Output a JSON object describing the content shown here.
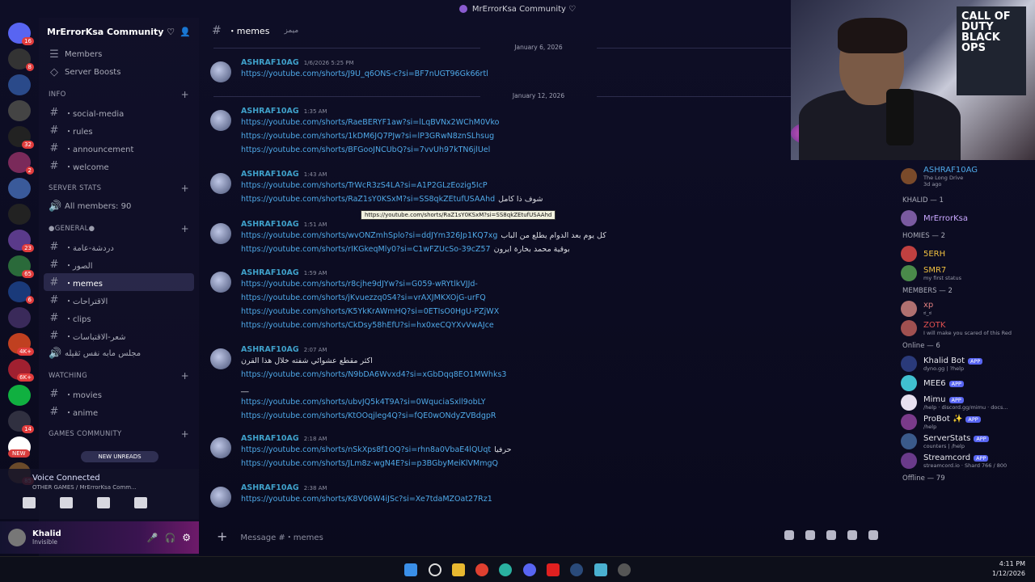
{
  "window_title": "MrErrorKsa Community ♡",
  "server": {
    "name": "MrErrorKsa Community ♡",
    "top_items": [
      "Members",
      "Server Boosts"
    ],
    "rail_badges": [
      "16",
      "8",
      "",
      "",
      "32",
      "2",
      "",
      "",
      "23",
      "65",
      "6",
      "",
      "4K+",
      "6K+",
      "",
      "14",
      "",
      "85"
    ],
    "new_badge": "NEW"
  },
  "categories": [
    {
      "name": "INFO",
      "channels": [
        {
          "name": "・social-media",
          "icon": "#"
        },
        {
          "name": "・rules",
          "icon": "#"
        },
        {
          "name": "・announcement",
          "icon": "#"
        },
        {
          "name": "・welcome",
          "icon": "#"
        }
      ]
    },
    {
      "name": "SERVER STATS",
      "channels": [
        {
          "name": "All members: 90",
          "icon": "speaker"
        }
      ]
    },
    {
      "name": "●GENERAL●",
      "channels": [
        {
          "name": "・دردشة-عامة",
          "icon": "#"
        },
        {
          "name": "・الصور",
          "icon": "#"
        },
        {
          "name": "・memes",
          "icon": "#",
          "active": true
        },
        {
          "name": "・الاقتراحات",
          "icon": "#"
        },
        {
          "name": "・clips",
          "icon": "#"
        },
        {
          "name": "・شعر-الاقتباسات",
          "icon": "#"
        },
        {
          "name": "مجلس مابه نفس ثقيله",
          "icon": "speaker"
        }
      ]
    },
    {
      "name": "WATCHING",
      "channels": [
        {
          "name": "・movies",
          "icon": "#"
        },
        {
          "name": "・anime",
          "icon": "#"
        }
      ]
    },
    {
      "name": "GAMES COMMUNITY",
      "channels": []
    }
  ],
  "new_unreads": "NEW UNREADS",
  "voice": {
    "title": "Voice Connected",
    "subtitle": "OTHER GAMES / MrErrorKsa Comm..."
  },
  "user": {
    "name": "Khalid",
    "status": "Invisible"
  },
  "channel_header": {
    "name": "・memes",
    "topic": "ميمز"
  },
  "dates": [
    "January 6, 2026",
    "January 12, 2026"
  ],
  "messages": [
    {
      "author": "ASHRAF10AG",
      "time": "1/6/2026 5:25 PM",
      "lines": [
        {
          "text": "https://youtube.com/shorts/J9U_q6ONS-c?si=BF7nUGT96Gk66rtl"
        }
      ]
    },
    {
      "author": "ASHRAF10AG",
      "time": "1:35 AM",
      "lines": [
        {
          "text": "https://youtube.com/shorts/RaeBERYF1aw?si=lLqBVNx2WChM0Vko"
        },
        {
          "text": "https://youtube.com/shorts/1kDM6JQ7PJw?si=lP3GRwN8znSLhsug"
        },
        {
          "text": "https://youtube.com/shorts/BFGooJNCUbQ?si=7vvUh97kTN6jlUel"
        }
      ]
    },
    {
      "author": "ASHRAF10AG",
      "time": "1:43 AM",
      "lines": [
        {
          "text": "https://youtube.com/shorts/TrWcR3zS4LA?si=A1P2GLzEozig5IcP"
        },
        {
          "text": "https://youtube.com/shorts/RaZ1sY0KSxM?si=SS8qkZEtufUSAAhd",
          "extra": "شوف ذا كامل"
        }
      ]
    },
    {
      "author": "ASHRAF10AG",
      "time": "1:51 AM",
      "lines": [
        {
          "text": "https://youtube.com/shorts/wvONZmhSplo?si=ddJYm326Jp1KQ7xg",
          "extra": "كل يوم بعد الدوام يطلع من الباب"
        },
        {
          "text": "https://youtube.com/shorts/rIKGkeqMly0?si=C1wFZUcSo-39cZ57",
          "extra": "بوقية محمد بخارة ايرون"
        }
      ]
    },
    {
      "author": "ASHRAF10AG",
      "time": "1:59 AM",
      "lines": [
        {
          "text": "https://youtube.com/shorts/r8cjhe9dJYw?si=G059-wRYtlkVJJd-"
        },
        {
          "text": "https://youtube.com/shorts/jKvuezzq0S4?si=vrAXJMKXOjG-urFQ"
        },
        {
          "text": "https://youtube.com/shorts/K5YkKrAWmHQ?si=0ETIsO0HgU-PZjWX"
        },
        {
          "text": "https://youtube.com/shorts/CkDsy58hEfU?si=hx0xeCQYXvVwAJce"
        }
      ]
    },
    {
      "author": "ASHRAF10AG",
      "time": "2:07 AM",
      "lines": [
        {
          "text": "اكثر مقطع عشوائي شفته خلال هذا القرن",
          "plain": true
        },
        {
          "text": "https://youtube.com/shorts/N9bDA6Wvxd4?si=xGbDqq8EO1MWhks3"
        },
        {
          "text": "__",
          "plain": true
        },
        {
          "text": "https://youtube.com/shorts/ubvJQ5k4T9A?si=0WquciaSxll9obLY"
        },
        {
          "text": "https://youtube.com/shorts/KtOOqjleg4Q?si=fQE0wONdyZVBdgpR"
        }
      ]
    },
    {
      "author": "ASHRAF10AG",
      "time": "2:18 AM",
      "lines": [
        {
          "text": "https://youtube.com/shorts/nSkXps8f1OQ?si=rhn8a0VbaE4lQUqt",
          "extra": "حرفيا"
        },
        {
          "text": "https://youtube.com/shorts/JLm8z-wgN4E?si=p3BGbyMeiKlVMmgQ"
        }
      ]
    },
    {
      "author": "ASHRAF10AG",
      "time": "2:38 AM",
      "lines": [
        {
          "text": "https://youtube.com/shorts/K8V06W4iJSc?si=Xe7tdaMZOat27Rz1"
        }
      ]
    }
  ],
  "tooltip": "https://youtube.com/shorts/RaZ1sY0KSxM?si=SS8qkZEtufUSAAhd",
  "composer": {
    "placeholder": "Message #・memes"
  },
  "members": {
    "activity": {
      "name": "ASHRAF10AG",
      "activity": "The Long Drive",
      "time": "3d ago"
    },
    "groups": [
      {
        "title": "KHALID — 1",
        "items": [
          {
            "name": "MrErrorKsa",
            "color": "#c9a7ff"
          }
        ]
      },
      {
        "title": "HOMIES — 2",
        "items": [
          {
            "name": "5ERH",
            "color": "#f0c040"
          },
          {
            "name": "SMR7",
            "color": "#f0c040",
            "status": "my first status"
          }
        ]
      },
      {
        "title": "MEMBERS — 2",
        "items": [
          {
            "name": "xp",
            "color": "#e08080",
            "status": "ಠ_ಠ"
          },
          {
            "name": "ZOTK",
            "color": "#e05050",
            "status": "I will make you scared of this Red"
          }
        ]
      },
      {
        "title": "Online — 6",
        "items": [
          {
            "name": "Khalid Bot",
            "color": "#e8e8ee",
            "badge": "APP",
            "status": "dyno.gg | ?help"
          },
          {
            "name": "MEE6",
            "color": "#e8e8ee",
            "badge": "APP"
          },
          {
            "name": "Mimu",
            "color": "#e8e8ee",
            "badge": "APP",
            "status": "/help · discord.gg/mimu · docs..."
          },
          {
            "name": "ProBot ✨",
            "color": "#e8e8ee",
            "badge": "APP",
            "status": "/help"
          },
          {
            "name": "ServerStats",
            "color": "#e8e8ee",
            "badge": "APP",
            "status": "counters | /help"
          },
          {
            "name": "Streamcord",
            "color": "#e8e8ee",
            "badge": "APP",
            "status": "streamcord.io · Shard 766 / 800"
          }
        ]
      },
      {
        "title": "Offline — 79",
        "items": []
      }
    ]
  },
  "webcam": {
    "poster_text": "CALL OF DUTY BLACK OPS"
  },
  "taskbar": {
    "time": "4:11 PM",
    "date": "1/12/2026"
  }
}
